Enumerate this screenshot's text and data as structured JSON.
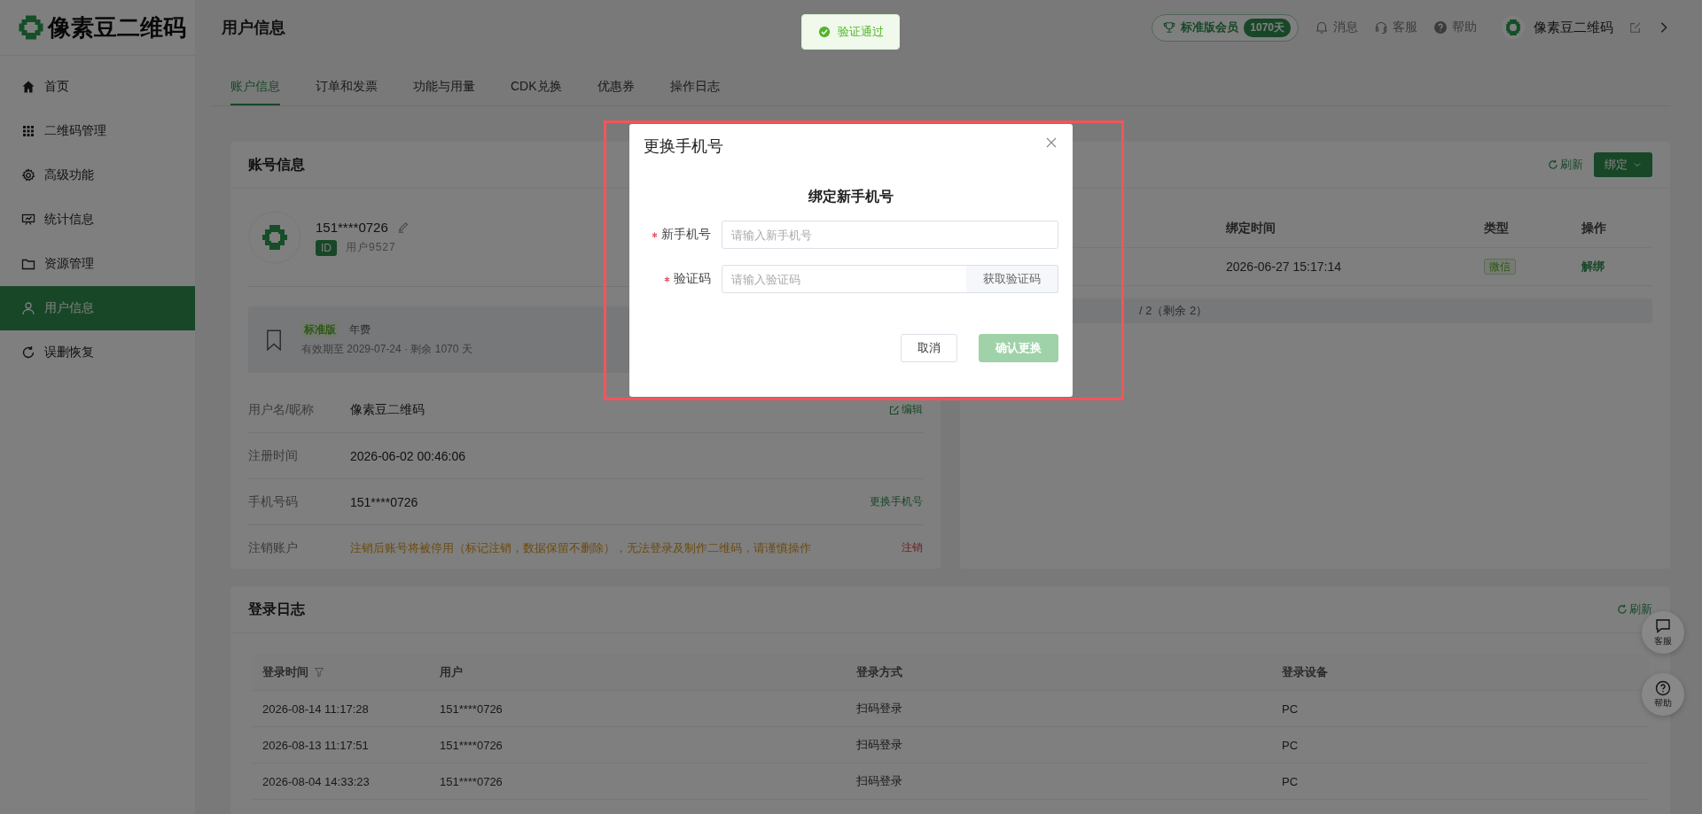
{
  "app": {
    "logo_text": "像素豆二维码"
  },
  "sidebar": {
    "items": [
      {
        "label": "首页",
        "selected": false
      },
      {
        "label": "二维码管理",
        "selected": false
      },
      {
        "label": "高级功能",
        "selected": false
      },
      {
        "label": "统计信息",
        "selected": false
      },
      {
        "label": "资源管理",
        "selected": false
      },
      {
        "label": "用户信息",
        "selected": true
      },
      {
        "label": "误删恢复",
        "selected": false
      }
    ]
  },
  "header": {
    "title": "用户信息",
    "membership": {
      "label": "标准版会员",
      "days": "1070天"
    },
    "links": [
      {
        "label": "消息"
      },
      {
        "label": "客服"
      },
      {
        "label": "帮助"
      }
    ],
    "user": {
      "name": "像素豆二维码"
    }
  },
  "tabs": [
    {
      "label": "账户信息",
      "selected": true
    },
    {
      "label": "订单和发票",
      "selected": false
    },
    {
      "label": "功能与用量",
      "selected": false
    },
    {
      "label": "CDK兑换",
      "selected": false
    },
    {
      "label": "优惠券",
      "selected": false
    },
    {
      "label": "操作日志",
      "selected": false
    }
  ],
  "account_card": {
    "title": "账号信息",
    "phone": "151****0726",
    "id_badge": "ID",
    "user_id": "用户9527",
    "plan": {
      "edition": "标准版",
      "billing": "年费",
      "validity": "有效期至 2029-07-24 · 剩余 1070 天"
    },
    "fields": [
      {
        "label": "用户名/昵称",
        "value": "像素豆二维码",
        "action": "编辑",
        "kind": "editable"
      },
      {
        "label": "注册时间",
        "value": "2026-06-02 00:46:06",
        "kind": "plain"
      },
      {
        "label": "手机号码",
        "value": "151****0726",
        "action": "更换手机号",
        "kind": "link"
      },
      {
        "label": "注销账户",
        "value": "注销后账号将被停用（标记注销，数据保留不删除），无法登录及制作二维码，请谨慎操作",
        "action": "注销",
        "kind": "danger"
      }
    ]
  },
  "binding_card": {
    "refresh": "刷新",
    "bind_button": "绑定",
    "columns": [
      "绑定时间",
      "类型",
      "操作"
    ],
    "rows": [
      {
        "time": "2026-06-27 15:17:14",
        "type": "微信",
        "action": "解绑"
      }
    ],
    "quota": "/ 2（剩余 2）"
  },
  "login_log": {
    "title": "登录日志",
    "refresh": "刷新",
    "columns": [
      {
        "label": "登录时间",
        "filter": true
      },
      {
        "label": "用户",
        "filter": false
      },
      {
        "label": "登录方式",
        "filter": false
      },
      {
        "label": "登录设备",
        "filter": false
      }
    ],
    "rows": [
      [
        "2026-08-14 11:17:28",
        "151****0726",
        "扫码登录",
        "PC"
      ],
      [
        "2026-08-13 11:17:51",
        "151****0726",
        "扫码登录",
        "PC"
      ],
      [
        "2026-08-04 14:33:23",
        "151****0726",
        "扫码登录",
        "PC"
      ]
    ]
  },
  "float_buttons": [
    {
      "label": "客服"
    },
    {
      "label": "帮助"
    }
  ],
  "toast": {
    "kind": "success",
    "text": "验证通过"
  },
  "modal": {
    "title": "更换手机号",
    "heading": "绑定新手机号",
    "fields": [
      {
        "label": "新手机号",
        "required": true,
        "placeholder": "请输入新手机号"
      },
      {
        "label": "验证码",
        "required": true,
        "placeholder": "请输入验证码",
        "addon": "获取验证码"
      }
    ],
    "buttons": [
      {
        "label": "取消",
        "kind": "default",
        "disabled": false
      },
      {
        "label": "确认更换",
        "kind": "primary",
        "disabled": true
      }
    ]
  }
}
